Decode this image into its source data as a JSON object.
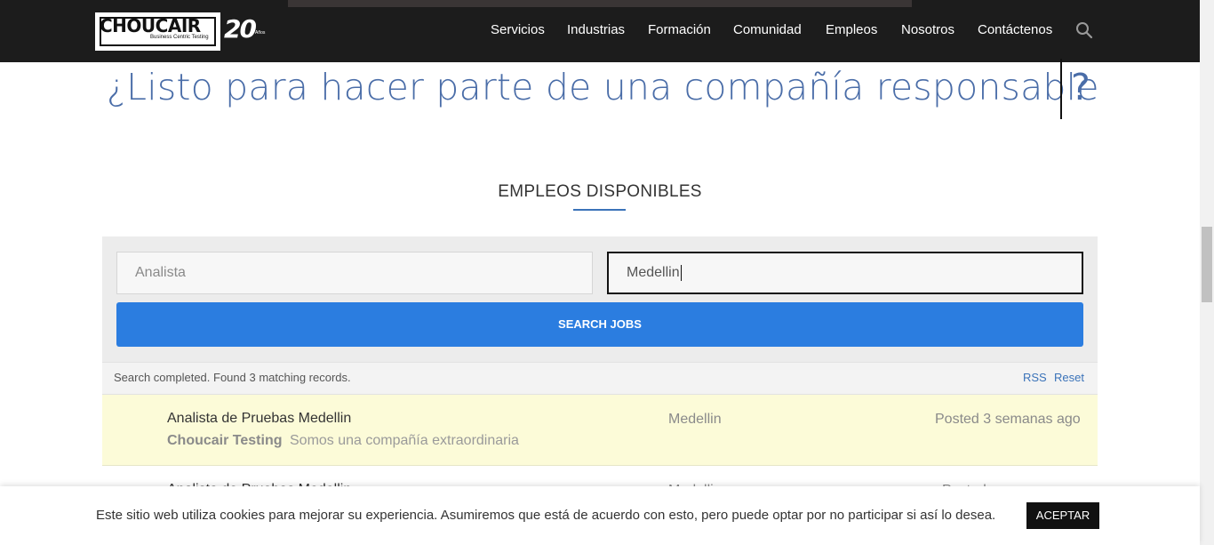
{
  "brand": {
    "name": "CHOUCAIR",
    "tagline": "Business Centric Testing",
    "anniversary": "20",
    "anniversary_sub": "Años"
  },
  "nav": {
    "items": [
      {
        "label": "Servicios"
      },
      {
        "label": "Industrias"
      },
      {
        "label": "Formación"
      },
      {
        "label": "Comunidad"
      },
      {
        "label": "Empleos"
      },
      {
        "label": "Nosotros"
      },
      {
        "label": "Contáctenos"
      }
    ],
    "search_icon": "search-icon"
  },
  "hero": {
    "headline": "¿Listo para hacer parte de una compañía responsable",
    "question_mark": "?"
  },
  "section": {
    "title": "EMPLEOS DISPONIBLES"
  },
  "search": {
    "keywords_placeholder": "Analista",
    "location_value": "Medellin",
    "button_label": "SEARCH JOBS"
  },
  "status": {
    "message": "Search completed. Found 3 matching records.",
    "rss_label": "RSS",
    "reset_label": "Reset"
  },
  "jobs": [
    {
      "title": "Analista de Pruebas Medellin",
      "company": "Choucair Testing",
      "tagline": "Somos una compañía extraordinaria",
      "location": "Medellin",
      "posted": "Posted 3 semanas ago"
    },
    {
      "title": "Analista de Pruebas Medellin",
      "location": "Medellin",
      "posted": "Posted"
    }
  ],
  "cookie": {
    "message": "Este sitio web utiliza cookies para mejorar su experiencia. Asumiremos que está de acuerdo con esto, pero puede optar por no participar si así lo desea.",
    "accept_label": "ACEPTAR"
  },
  "colors": {
    "header_bg": "#1c1c1c",
    "headline": "#4a6da8",
    "button": "#2b7de0",
    "highlight_row": "#fcfbd8",
    "link": "#3b73b9"
  }
}
